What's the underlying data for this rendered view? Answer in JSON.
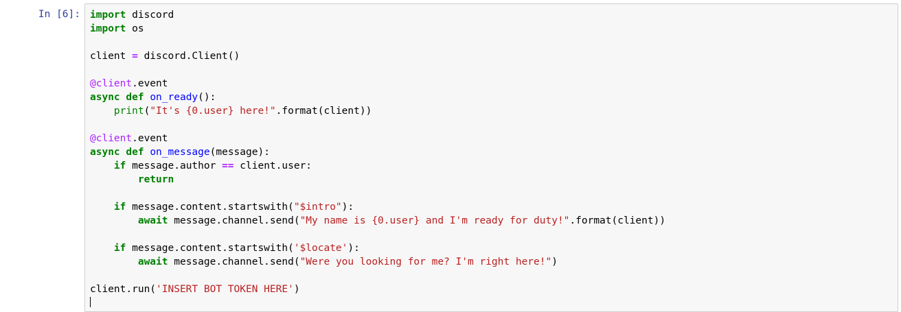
{
  "cell": {
    "prompt": "In [6]:",
    "lines": [
      [
        {
          "c": "kw",
          "t": "import"
        },
        {
          "c": "",
          "t": " discord"
        }
      ],
      [
        {
          "c": "kw",
          "t": "import"
        },
        {
          "c": "",
          "t": " os"
        }
      ],
      [],
      [
        {
          "c": "",
          "t": "client "
        },
        {
          "c": "op",
          "t": "="
        },
        {
          "c": "",
          "t": " discord.Client()"
        }
      ],
      [],
      [
        {
          "c": "dec",
          "t": "@client"
        },
        {
          "c": "",
          "t": ".event"
        }
      ],
      [
        {
          "c": "kw",
          "t": "async"
        },
        {
          "c": "",
          "t": " "
        },
        {
          "c": "kw",
          "t": "def"
        },
        {
          "c": "",
          "t": " "
        },
        {
          "c": "fn",
          "t": "on_ready"
        },
        {
          "c": "",
          "t": "():"
        }
      ],
      [
        {
          "c": "",
          "t": "    "
        },
        {
          "c": "bi",
          "t": "print"
        },
        {
          "c": "",
          "t": "("
        },
        {
          "c": "str",
          "t": "\"It's {0.user} here!\""
        },
        {
          "c": "",
          "t": ".format(client))"
        }
      ],
      [],
      [
        {
          "c": "dec",
          "t": "@client"
        },
        {
          "c": "",
          "t": ".event"
        }
      ],
      [
        {
          "c": "kw",
          "t": "async"
        },
        {
          "c": "",
          "t": " "
        },
        {
          "c": "kw",
          "t": "def"
        },
        {
          "c": "",
          "t": " "
        },
        {
          "c": "fn",
          "t": "on_message"
        },
        {
          "c": "",
          "t": "(message):"
        }
      ],
      [
        {
          "c": "",
          "t": "    "
        },
        {
          "c": "kw",
          "t": "if"
        },
        {
          "c": "",
          "t": " message.author "
        },
        {
          "c": "op",
          "t": "=="
        },
        {
          "c": "",
          "t": " client.user:"
        }
      ],
      [
        {
          "c": "",
          "t": "        "
        },
        {
          "c": "kw",
          "t": "return"
        }
      ],
      [],
      [
        {
          "c": "",
          "t": "    "
        },
        {
          "c": "kw",
          "t": "if"
        },
        {
          "c": "",
          "t": " message.content.startswith("
        },
        {
          "c": "str",
          "t": "\"$intro\""
        },
        {
          "c": "",
          "t": "):"
        }
      ],
      [
        {
          "c": "",
          "t": "        "
        },
        {
          "c": "kw",
          "t": "await"
        },
        {
          "c": "",
          "t": " message.channel.send("
        },
        {
          "c": "str",
          "t": "\"My name is {0.user} and I'm ready for duty!\""
        },
        {
          "c": "",
          "t": ".format(client))"
        }
      ],
      [],
      [
        {
          "c": "",
          "t": "    "
        },
        {
          "c": "kw",
          "t": "if"
        },
        {
          "c": "",
          "t": " message.content.startswith("
        },
        {
          "c": "str",
          "t": "'$locate'"
        },
        {
          "c": "",
          "t": "):"
        }
      ],
      [
        {
          "c": "",
          "t": "        "
        },
        {
          "c": "kw",
          "t": "await"
        },
        {
          "c": "",
          "t": " message.channel.send("
        },
        {
          "c": "str",
          "t": "\"Were you looking for me? I'm right here!\""
        },
        {
          "c": "",
          "t": ")"
        }
      ],
      [],
      [
        {
          "c": "",
          "t": "client.run("
        },
        {
          "c": "str",
          "t": "'INSERT BOT TOKEN HERE'"
        },
        {
          "c": "",
          "t": ")"
        }
      ]
    ]
  },
  "colors": {
    "prompt": "#303f9f",
    "keyword": "#008000",
    "operator": "#aa22ff",
    "decorator": "#aa22ff",
    "string": "#ba2121",
    "function_name": "#0000ff",
    "editor_background": "#f7f7f7",
    "editor_border": "#cfcfcf"
  }
}
